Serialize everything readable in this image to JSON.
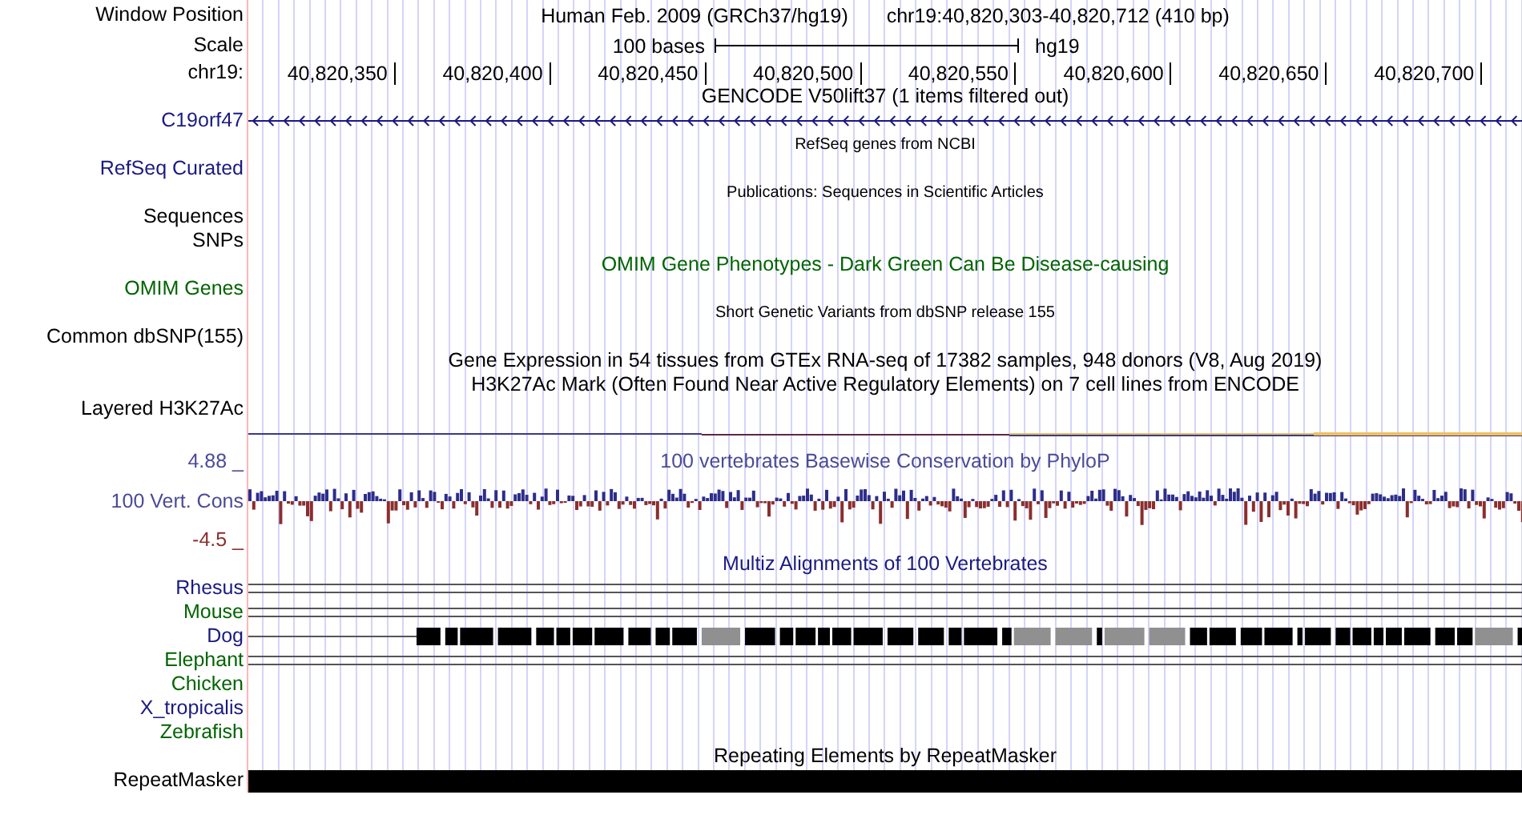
{
  "header": {
    "label": "Window Position",
    "assembly": "Human Feb. 2009 (GRCh37/hg19)",
    "position": "chr19:40,820,303-40,820,712 (410 bp)"
  },
  "scale": {
    "label": "Scale",
    "bar_text": "100 bases",
    "assembly": "hg19"
  },
  "ruler": {
    "label": "chr19:",
    "ticks": [
      "40,820,350",
      "40,820,400",
      "40,820,450",
      "40,820,500",
      "40,820,550",
      "40,820,600",
      "40,820,650",
      "40,820,700"
    ]
  },
  "tracks": [
    {
      "kind": "title",
      "text": "GENCODE V50lift37 (1 items filtered out)",
      "color": "#000000"
    },
    {
      "kind": "gene",
      "label": "C19orf47",
      "color": "#1a1a80"
    },
    {
      "kind": "small_title",
      "text": "RefSeq genes from NCBI",
      "color": "#000000"
    },
    {
      "kind": "label",
      "label": "RefSeq Curated",
      "color": "#1a1a80"
    },
    {
      "kind": "small_title",
      "text": "Publications: Sequences in Scientific Articles",
      "color": "#000000"
    },
    {
      "kind": "label",
      "label": "Sequences",
      "color": "#000000"
    },
    {
      "kind": "label",
      "label": "SNPs",
      "color": "#000000"
    },
    {
      "kind": "title",
      "text": "OMIM Gene Phenotypes - Dark Green Can Be Disease-causing",
      "color": "#006400"
    },
    {
      "kind": "label",
      "label": "OMIM Genes",
      "color": "#006400"
    },
    {
      "kind": "small_title",
      "text": "Short Genetic Variants from dbSNP release 155",
      "color": "#000000"
    },
    {
      "kind": "label",
      "label": "Common dbSNP(155)",
      "color": "#000000"
    },
    {
      "kind": "title",
      "text": "Gene Expression in 54 tissues from GTEx RNA-seq of 17382 samples, 948 donors (V8, Aug 2019)",
      "color": "#000000"
    },
    {
      "kind": "title",
      "text": "H3K27Ac Mark (Often Found Near Active Regulatory Elements) on 7 cell lines from ENCODE",
      "color": "#000000"
    },
    {
      "kind": "label",
      "label": "Layered H3K27Ac",
      "color": "#000000"
    },
    {
      "kind": "signal"
    },
    {
      "kind": "title",
      "label": "4.88 _",
      "text": "100 vertebrates Basewise Conservation by PhyloP",
      "color": "#4b4b96"
    },
    {
      "kind": "phylop",
      "label": "100 Vert. Cons",
      "color": "#4b4b96"
    },
    {
      "kind": "label",
      "label": "-4.5 _",
      "color": "#8b2e2e"
    },
    {
      "kind": "title",
      "text": "Multiz Alignments of 100 Vertebrates",
      "color": "#1a1a80"
    },
    {
      "kind": "lines",
      "label": "Rhesus",
      "color": "#1a1a80"
    },
    {
      "kind": "lines",
      "label": "Mouse",
      "color": "#006400"
    },
    {
      "kind": "blocks",
      "label": "Dog",
      "color": "#1a1a80"
    },
    {
      "kind": "lines",
      "label": "Elephant",
      "color": "#006400"
    },
    {
      "kind": "label",
      "label": "Chicken",
      "color": "#006400"
    },
    {
      "kind": "label",
      "label": "X_tropicalis",
      "color": "#1a1a80"
    },
    {
      "kind": "label",
      "label": "Zebrafish",
      "color": "#006400"
    },
    {
      "kind": "title",
      "text": "Repeating Elements by RepeatMasker",
      "color": "#000000"
    },
    {
      "kind": "repeat",
      "label": "RepeatMasker",
      "color": "#000000"
    }
  ]
}
